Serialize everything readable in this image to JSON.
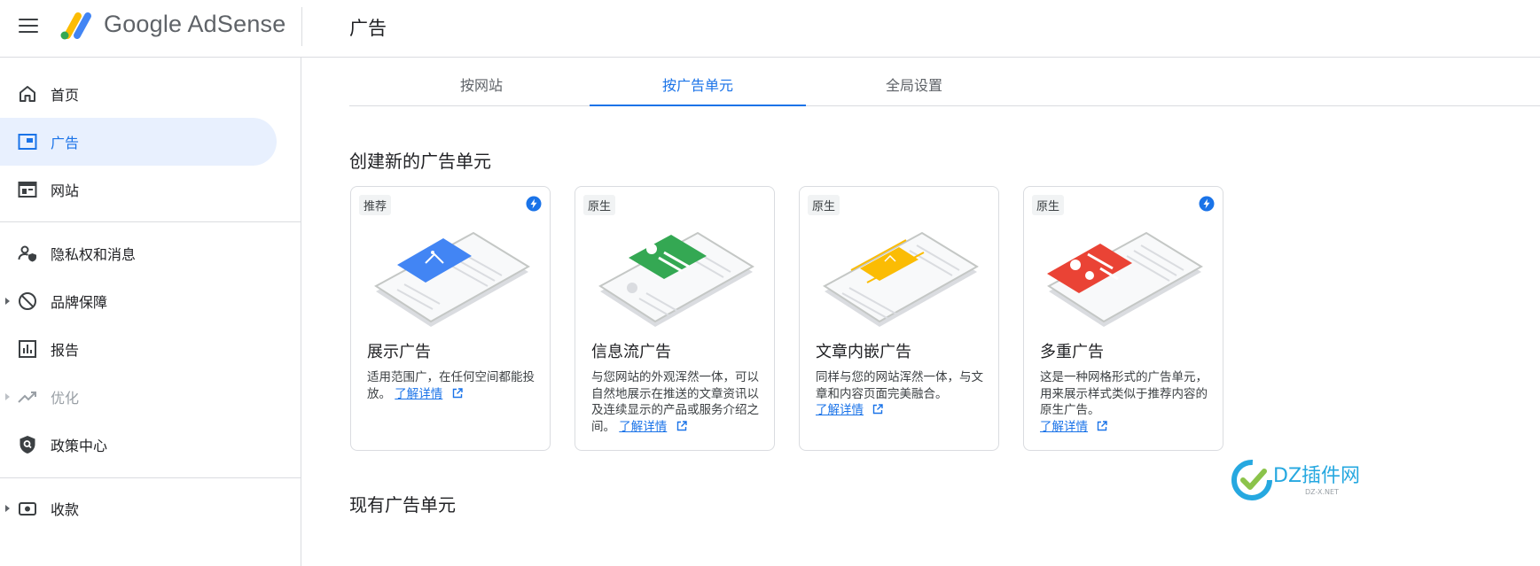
{
  "app": {
    "logo_text": "Google AdSense",
    "page_title": "广告"
  },
  "sidebar": {
    "items": [
      {
        "label": "首页",
        "icon": "home-icon"
      },
      {
        "label": "广告",
        "icon": "ads-icon",
        "active": true
      },
      {
        "label": "网站",
        "icon": "sites-icon"
      },
      {
        "label": "隐私权和消息",
        "icon": "privacy-icon"
      },
      {
        "label": "品牌保障",
        "icon": "block-icon",
        "expandable": true
      },
      {
        "label": "报告",
        "icon": "reports-icon"
      },
      {
        "label": "优化",
        "icon": "trending-icon",
        "expandable": true,
        "disabled": true
      },
      {
        "label": "政策中心",
        "icon": "policy-icon"
      },
      {
        "label": "收款",
        "icon": "payments-icon",
        "expandable": true
      }
    ]
  },
  "tabs": [
    {
      "label": "按网站"
    },
    {
      "label": "按广告单元",
      "active": true
    },
    {
      "label": "全局设置"
    }
  ],
  "create_section": {
    "heading": "创建新的广告单元",
    "cards": [
      {
        "chip": "推荐",
        "bolt": true,
        "title": "展示广告",
        "desc": "适用范围广，在任何空间都能投放。",
        "link": "了解详情",
        "color": "#4285f4"
      },
      {
        "chip": "原生",
        "bolt": false,
        "title": "信息流广告",
        "desc": "与您网站的外观浑然一体，可以自然地展示在推送的文章资讯以及连续显示的产品或服务介绍之间。",
        "link": "了解详情",
        "color": "#34a853"
      },
      {
        "chip": "原生",
        "bolt": false,
        "title": "文章内嵌广告",
        "desc": "同样与您的网站浑然一体，与文章和内容页面完美融合。",
        "link": "了解详情",
        "color": "#fbbc04"
      },
      {
        "chip": "原生",
        "bolt": true,
        "title": "多重广告",
        "desc": "这是一种网格形式的广告单元，用来展示样式类似于推荐内容的原生广告。",
        "link": "了解详情",
        "color": "#ea4335"
      }
    ]
  },
  "existing_section": {
    "heading": "现有广告单元"
  },
  "watermark": {
    "text": "DZ插件网",
    "subtext": "DZ-X.NET"
  },
  "colors": {
    "accent": "#1a73e8",
    "active_bg": "#e8f0fe"
  }
}
